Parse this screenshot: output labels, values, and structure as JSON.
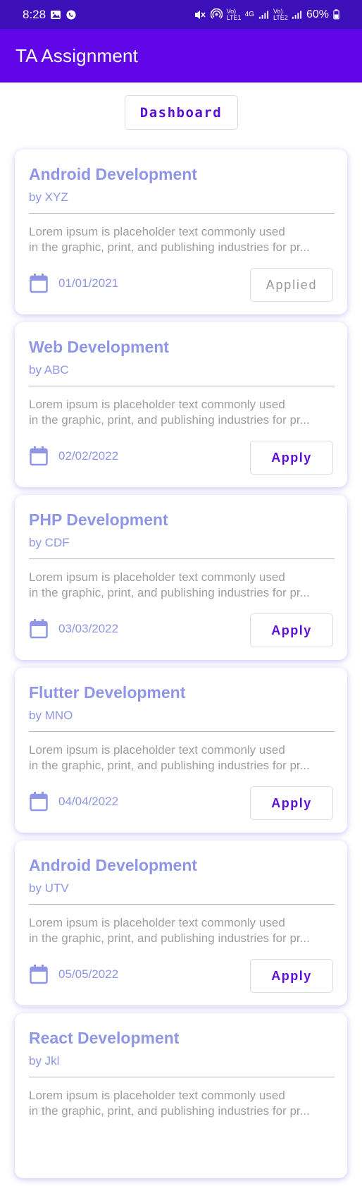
{
  "status_bar": {
    "time": "8:28",
    "battery": "60%",
    "network_labels": [
      "Vo) LTE1",
      "4G",
      "Vo) LTE2"
    ]
  },
  "app_bar": {
    "title": "TA Assignment"
  },
  "dashboard_button": {
    "label": "Dashboard"
  },
  "colors": {
    "status_bar": "#3d0fb8",
    "app_bar": "#6106e6",
    "card_accent": "#8f96e6",
    "button_text": "#5b0fd6"
  },
  "cards": [
    {
      "title": "Android Development",
      "author": "by XYZ",
      "description_line1": "Lorem ipsum is placeholder text commonly used",
      "description_line2": "in the graphic, print, and publishing industries for pr...",
      "date": "01/01/2021",
      "button_label": "Applied"
    },
    {
      "title": "Web Development",
      "author": "by ABC",
      "description_line1": "Lorem ipsum is placeholder text commonly used",
      "description_line2": "in the graphic, print, and publishing industries for pr...",
      "date": "02/02/2022",
      "button_label": "Apply"
    },
    {
      "title": "PHP Development",
      "author": "by CDF",
      "description_line1": "Lorem ipsum is placeholder text commonly used",
      "description_line2": "in the graphic, print, and publishing industries for pr...",
      "date": "03/03/2022",
      "button_label": "Apply"
    },
    {
      "title": "Flutter Development",
      "author": "by MNO",
      "description_line1": "Lorem ipsum is placeholder text commonly used",
      "description_line2": "in the graphic, print, and publishing industries for pr...",
      "date": "04/04/2022",
      "button_label": "Apply"
    },
    {
      "title": "Android Development",
      "author": "by UTV",
      "description_line1": "Lorem ipsum is placeholder text commonly used",
      "description_line2": "in the graphic, print, and publishing industries for pr...",
      "date": "05/05/2022",
      "button_label": "Apply"
    },
    {
      "title": "React Development",
      "author": "by Jkl",
      "description_line1": "Lorem ipsum is placeholder text commonly used",
      "description_line2": "in the graphic, print, and publishing industries for pr...",
      "date": "",
      "button_label": ""
    }
  ]
}
